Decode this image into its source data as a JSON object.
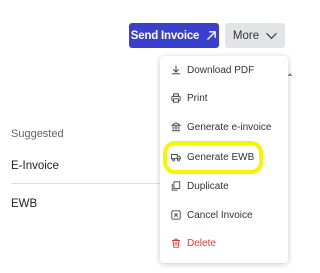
{
  "toolbar": {
    "send_invoice_label": "Send Invoice",
    "more_label": "More",
    "send_color": "#3b3fce"
  },
  "left_panel": {
    "section_label": "Suggested",
    "items": [
      "E-Invoice",
      "EWB"
    ]
  },
  "dropdown": {
    "items": [
      {
        "label": "Download PDF",
        "icon": "download-icon"
      },
      {
        "label": "Print",
        "icon": "printer-icon"
      },
      {
        "label": "Generate e-invoice",
        "icon": "bank-icon"
      },
      {
        "label": "Generate EWB",
        "icon": "truck-icon",
        "highlighted": true
      },
      {
        "label": "Duplicate",
        "icon": "copy-icon"
      },
      {
        "label": "Cancel Invoice",
        "icon": "cancel-icon"
      },
      {
        "label": "Delete",
        "icon": "trash-icon",
        "danger": true
      }
    ],
    "highlight_color": "#f5f500",
    "danger_color": "#d93b3b"
  }
}
